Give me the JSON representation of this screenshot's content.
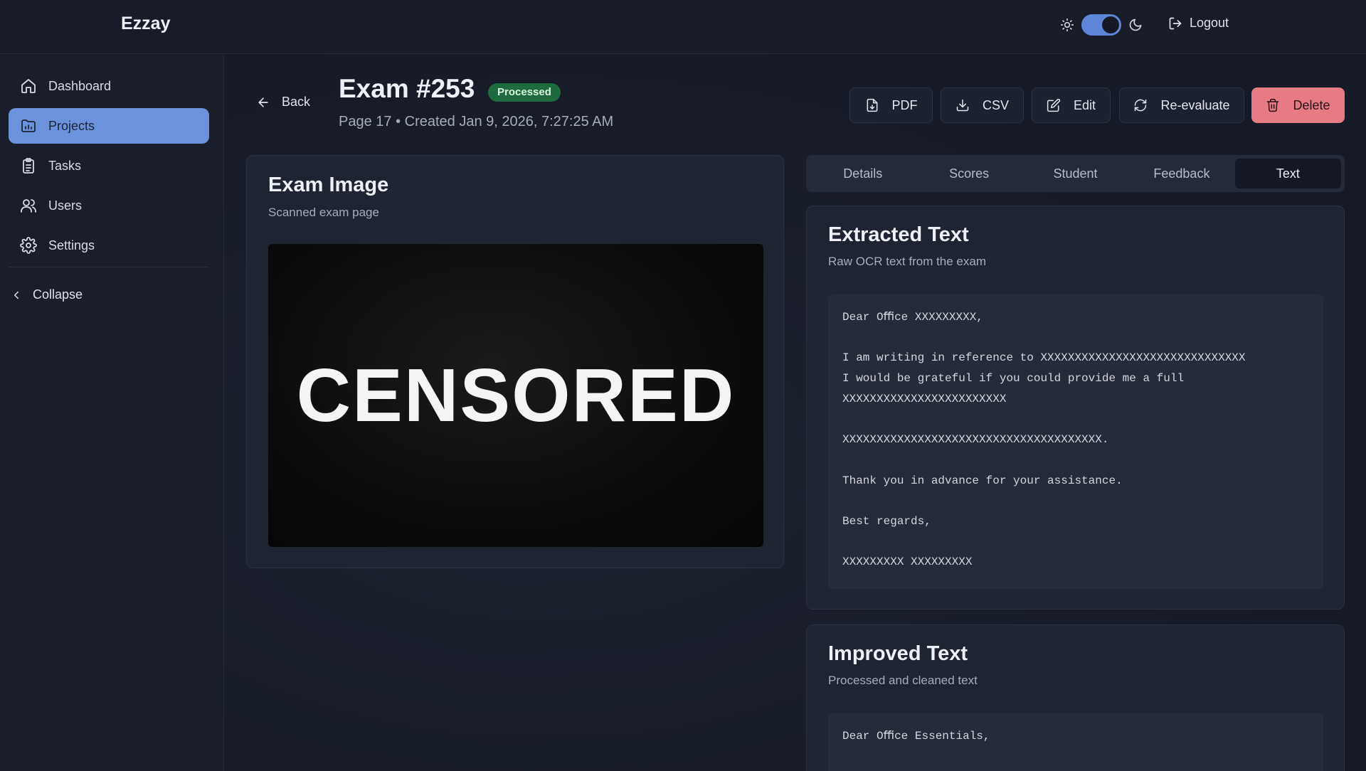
{
  "app": {
    "brand": "Ezzay"
  },
  "header": {
    "logout_label": "Logout"
  },
  "sidebar": {
    "items": [
      {
        "label": "Dashboard",
        "icon": "home-icon"
      },
      {
        "label": "Projects",
        "icon": "folder-chart-icon",
        "active": true
      },
      {
        "label": "Tasks",
        "icon": "clipboard-icon"
      },
      {
        "label": "Users",
        "icon": "users-icon"
      },
      {
        "label": "Settings",
        "icon": "gear-icon"
      }
    ],
    "collapse_label": "Collapse"
  },
  "exam": {
    "back_label": "Back",
    "title": "Exam #253",
    "status": "Processed",
    "subtitle": "Page 17 • Created Jan 9, 2026, 7:27:25 AM"
  },
  "toolbar": {
    "pdf": "PDF",
    "csv": "CSV",
    "edit": "Edit",
    "reevaluate": "Re-evaluate",
    "delete": "Delete"
  },
  "image_panel": {
    "title": "Exam Image",
    "subtitle": "Scanned exam page",
    "overlay_text": "CENSORED"
  },
  "tabs": [
    "Details",
    "Scores",
    "Student",
    "Feedback",
    "Text"
  ],
  "active_tab": "Text",
  "extracted": {
    "title": "Extracted Text",
    "subtitle": "Raw OCR text from the exam",
    "text": "Dear Oﬃce XXXXXXXXX,\n\nI am writing in reference to XXXXXXXXXXXXXXXXXXXXXXXXXXXXXX\nI would be grateful if you could provide me a full\nXXXXXXXXXXXXXXXXXXXXXXXX\n\nXXXXXXXXXXXXXXXXXXXXXXXXXXXXXXXXXXXXXX.\n\nThank you in advance for your assistance.\n\nBest regards,\n\nXXXXXXXXX XXXXXXXXX"
  },
  "improved": {
    "title": "Improved Text",
    "subtitle": "Processed and cleaned text",
    "text": "Dear Oﬃce Essentials,"
  },
  "colors": {
    "accent": "#6b93dc",
    "danger": "#e67b86",
    "success": "#1f6b3f",
    "background": "#171b28"
  }
}
